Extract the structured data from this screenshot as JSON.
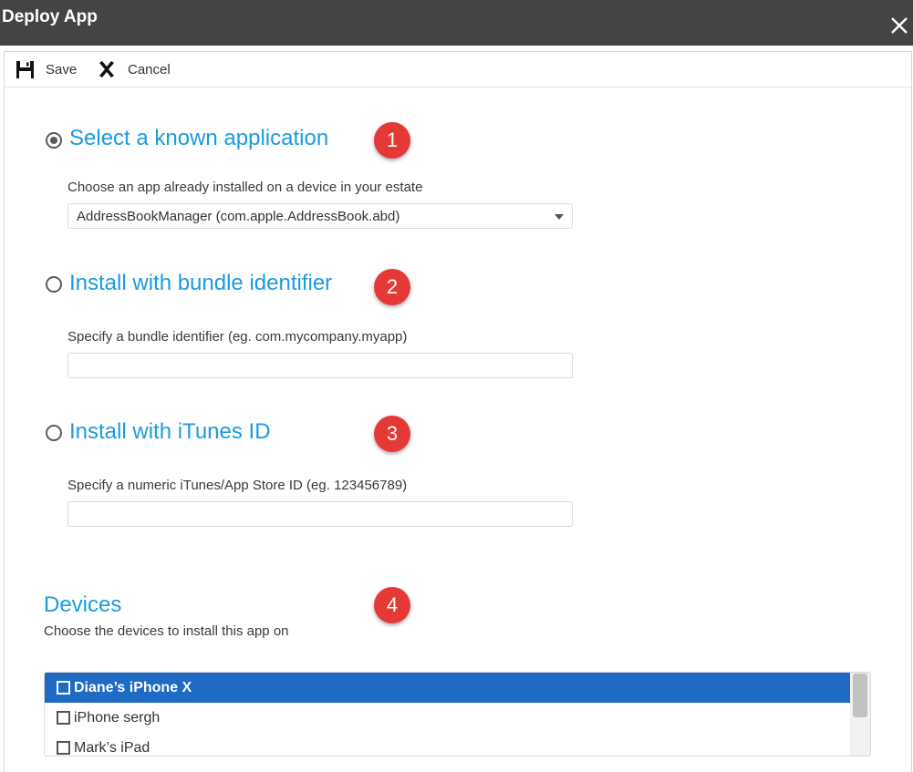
{
  "window": {
    "title": "Deploy App",
    "close_icon": "close-icon"
  },
  "toolbar": {
    "save_label": "Save",
    "save_icon": "floppy-disk-icon",
    "cancel_label": "Cancel",
    "cancel_icon": "x-icon"
  },
  "options": [
    {
      "heading": "Select a known application",
      "badge": "1",
      "checked": true,
      "field_label": "Choose an app already installed on a device in your estate",
      "select_value": "AddressBookManager (com.apple.AddressBook.abd)"
    },
    {
      "heading": "Install with bundle identifier",
      "badge": "2",
      "checked": false,
      "field_label": "Specify a bundle identifier (eg. com.mycompany.myapp)",
      "input_value": ""
    },
    {
      "heading": "Install with iTunes ID",
      "badge": "3",
      "checked": false,
      "field_label": "Specify a numeric iTunes/App Store ID (eg. 123456789)",
      "input_value": ""
    }
  ],
  "devices": {
    "heading": "Devices",
    "badge": "4",
    "subtitle": "Choose the devices to install this app on",
    "items": [
      {
        "label": "Diane’s iPhone X",
        "selected": true,
        "checked": false
      },
      {
        "label": "iPhone sergh",
        "selected": false,
        "checked": false
      },
      {
        "label": "Mark’s iPad",
        "selected": false,
        "checked": false
      }
    ]
  },
  "colors": {
    "titlebar": "#444444",
    "accent_heading": "#1a9be0",
    "badge": "#e53935",
    "selected_row": "#1e6ac4"
  }
}
